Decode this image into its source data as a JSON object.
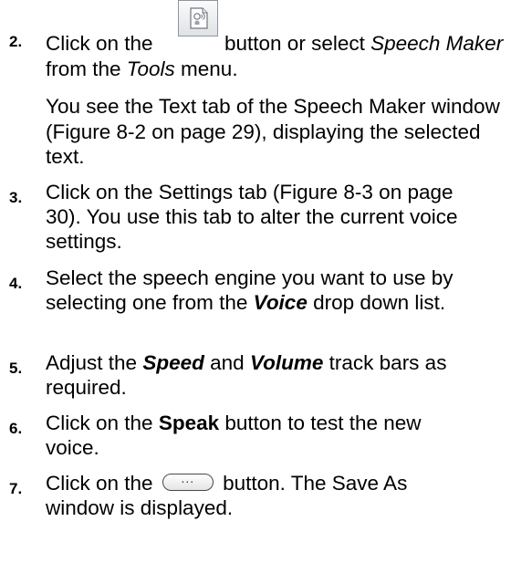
{
  "steps": [
    {
      "number": "2.",
      "text_a": "Click on the",
      "button_icon": "speech-maker-icon",
      "text_b": "button or select",
      "menu_item": "Speech Maker",
      "text_c": "from the",
      "menu": "Tools",
      "text_d": "menu.",
      "note": "You see the Text tab of the Speech Maker window (Figure 8-2 on page 29), displaying the selected text."
    },
    {
      "number": "3.",
      "text": "Click on the Settings tab (Figure 8-3 on page 30). You use this tab to alter the current voice settings."
    },
    {
      "number": "4.",
      "text_a": "Select the speech engine you want to use by selecting one from the",
      "field": "Voice",
      "text_b": "drop down list."
    },
    {
      "number": "5.",
      "text_a": "Adjust the",
      "field1": "Speed",
      "text_b": "and",
      "field2": "Volume",
      "text_c": "track bars as required."
    },
    {
      "number": "6.",
      "text_a": "Click on the",
      "button": "Speak",
      "text_b": "button to test the new voice."
    },
    {
      "number": "7.",
      "text_a": "Click on the",
      "button_glyph": "...",
      "text_b": "button. The Save As window is displayed."
    }
  ],
  "colors": {
    "text": "#000000",
    "button_border": "#8e96a2"
  }
}
